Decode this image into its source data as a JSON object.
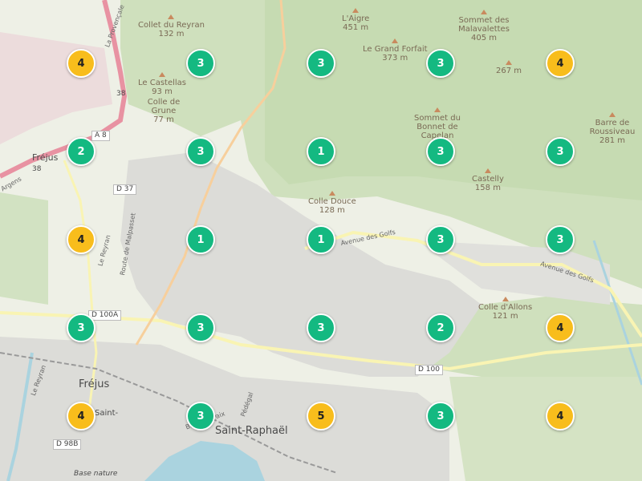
{
  "map": {
    "peaks": [
      {
        "name": "Collet du Reyran",
        "elev": "132 m"
      },
      {
        "name": "L'Aigre",
        "elev": "451 m"
      },
      {
        "name": "Sommet des Malavalettes",
        "elev": "405 m"
      },
      {
        "name": "Le Grand Forfait",
        "elev": "373 m"
      },
      {
        "name": "",
        "elev": "267 m"
      },
      {
        "name": "Le Castellas",
        "elev": "93 m"
      },
      {
        "name": "Colle de Grune",
        "elev": "77 m"
      },
      {
        "name": "Sommet du Bonnet de Capelan",
        "elev": ""
      },
      {
        "name": "Barre de Roussiveau",
        "elev": "281 m"
      },
      {
        "name": "Castelly",
        "elev": "158 m"
      },
      {
        "name": "Colle Douce",
        "elev": "128 m"
      },
      {
        "name": "Colle d'Allons",
        "elev": "121 m"
      }
    ],
    "towns": [
      "Fréjus",
      "Fréjus",
      "Saint-Raphaël",
      "Saint-",
      "Base nature"
    ],
    "town_numbers": [
      "38",
      "38"
    ],
    "road_refs": [
      "A 8",
      "D 37",
      "D 100A",
      "D 100",
      "D 98B"
    ],
    "street_names": [
      "Avenue des Golfs",
      "Avenue des Golfs",
      "Route de Malpasset",
      "Le Reyran",
      "La Provençale",
      "Le Reyran",
      "Bd de la Paix",
      "Pédégal",
      "Argens"
    ],
    "clusters": [
      {
        "count": "4",
        "color": "yellow"
      },
      {
        "count": "3",
        "color": "green"
      },
      {
        "count": "3",
        "color": "green"
      },
      {
        "count": "3",
        "color": "green"
      },
      {
        "count": "4",
        "color": "yellow"
      },
      {
        "count": "2",
        "color": "green"
      },
      {
        "count": "3",
        "color": "green"
      },
      {
        "count": "1",
        "color": "green"
      },
      {
        "count": "3",
        "color": "green"
      },
      {
        "count": "3",
        "color": "green"
      },
      {
        "count": "4",
        "color": "yellow"
      },
      {
        "count": "1",
        "color": "green"
      },
      {
        "count": "1",
        "color": "green"
      },
      {
        "count": "3",
        "color": "green"
      },
      {
        "count": "3",
        "color": "green"
      },
      {
        "count": "3",
        "color": "green"
      },
      {
        "count": "3",
        "color": "green"
      },
      {
        "count": "3",
        "color": "green"
      },
      {
        "count": "2",
        "color": "green"
      },
      {
        "count": "4",
        "color": "yellow"
      },
      {
        "count": "4",
        "color": "yellow"
      },
      {
        "count": "3",
        "color": "green"
      },
      {
        "count": "5",
        "color": "yellow"
      },
      {
        "count": "3",
        "color": "green"
      },
      {
        "count": "4",
        "color": "yellow"
      }
    ],
    "colors": {
      "cluster_green": "#14b981",
      "cluster_yellow": "#f8bd1c",
      "forest": "#cfe0bd",
      "urban": "#dcdcd8",
      "water": "#aad3df",
      "motorway": "#e892a2",
      "primary_road": "#f9f4b3"
    }
  }
}
